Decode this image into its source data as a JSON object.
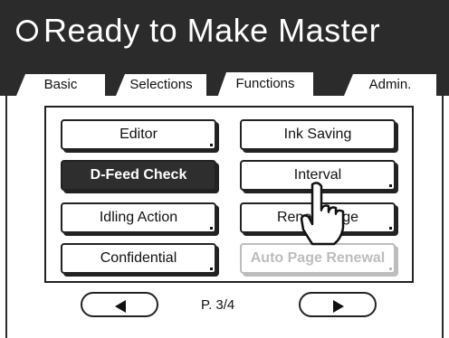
{
  "status": {
    "icon": "ring-icon",
    "text": "Ready to Make Master"
  },
  "tabs": [
    {
      "label": "Basic",
      "active": false
    },
    {
      "label": "Selections",
      "active": false
    },
    {
      "label": "Functions",
      "active": true
    },
    {
      "label": "Admin.",
      "active": false
    }
  ],
  "functions": {
    "buttons": [
      {
        "label": "Editor",
        "state": "normal"
      },
      {
        "label": "Ink Saving",
        "state": "normal"
      },
      {
        "label": "D-Feed Check",
        "state": "selected"
      },
      {
        "label": "Interval",
        "state": "normal"
      },
      {
        "label": "Idling Action",
        "state": "normal"
      },
      {
        "label": "Reno",
        "label_tail": "ge",
        "state": "normal"
      },
      {
        "label": "Confidential",
        "state": "normal"
      },
      {
        "label": "Auto Page Renewal",
        "state": "disabled"
      }
    ]
  },
  "pagination": {
    "prev_icon": "left-triangle-icon",
    "next_icon": "right-triangle-icon",
    "page_label": "P. 3/4"
  },
  "cursor": {
    "icon": "pointing-hand-icon"
  },
  "colors": {
    "dark": "#2b2b2b",
    "selected": "#2e2e2e",
    "disabled": "#bdbdbd",
    "background": "#ffffff"
  }
}
